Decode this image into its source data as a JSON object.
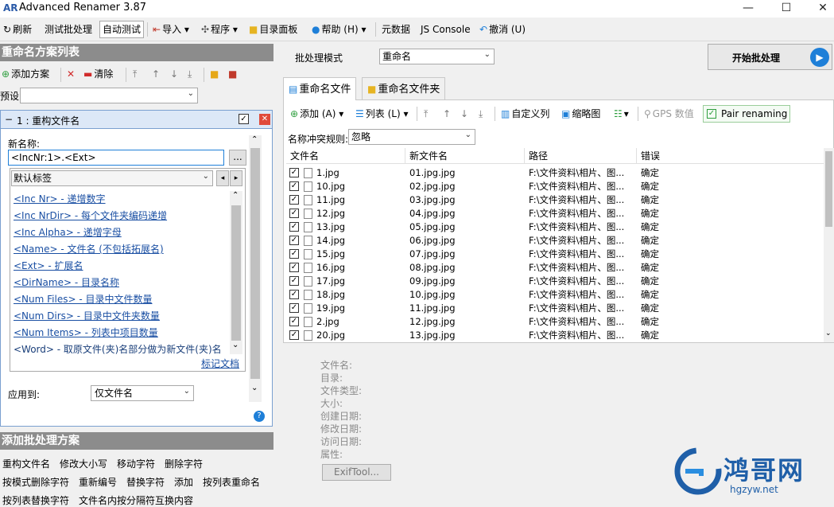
{
  "window": {
    "title": "Advanced Renamer 3.87",
    "app_icon": "AR",
    "minimize": "—",
    "maximize": "☐",
    "close": "✕"
  },
  "toolbar": {
    "refresh": "刷新",
    "test_batch": "测试批处理",
    "auto_test": "自动测试",
    "import": "导入",
    "program": "程序",
    "directory_panel": "目录面板",
    "help": "帮助 (H)",
    "metadata": "元数据",
    "js_console": "JS Console",
    "undo": "撤消 (U)"
  },
  "left": {
    "methods_header": "重命名方案列表",
    "add_method": "添加方案",
    "clear": "清除",
    "preset_label": "预设:",
    "preset_value": "",
    "method_title": "1 : 重构文件名",
    "method_collapse": "−",
    "new_name_label": "新名称:",
    "new_name_value": "<IncNr:1>.<Ext>",
    "browse": "...",
    "tag_group": "默认标签",
    "tags": [
      "<Inc Nr> - 递增数字",
      "<Inc NrDir> - 每个文件夹编码递增",
      "<Inc Alpha> - 递增字母",
      "<Name> - 文件名 (不包括拓展名)",
      "<Ext> - 扩展名",
      "<DirName> - 目录名称",
      "<Num Files> - 目录中文件数量",
      "<Num Dirs> - 目录中文件夹数量",
      "<Num Items> - 列表中项目数量",
      "<Word> - 取原文件(夹)名部分做为新文件(夹)名"
    ],
    "tag_docs": "标记文档",
    "apply_to_label": "应用到:",
    "apply_to_value": "仅文件名",
    "help_badge": "?",
    "batch_header": "添加批处理方案",
    "batch_methods_row1": [
      "重构文件名",
      "修改大小写",
      "移动字符",
      "删除字符"
    ],
    "batch_methods_row2": [
      "按模式删除字符",
      "重新编号",
      "替换字符",
      "添加",
      "按列表重命名"
    ],
    "batch_methods_row3": [
      "按列表替换字符",
      "文件名内按分隔符互换内容"
    ]
  },
  "right": {
    "batch_mode_label": "批处理模式",
    "batch_mode_value": "重命名",
    "start_button": "开始批处理",
    "tabs": [
      "重命名文件",
      "重命名文件夹"
    ],
    "add": "添加 (A)",
    "list": "列表 (L)",
    "custom_columns": "自定义列",
    "thumbnails": "缩略图",
    "gps": "GPS 数值",
    "pair_renaming": "Pair renaming",
    "conflict_label": "名称冲突规则:",
    "conflict_value": "忽略",
    "columns": [
      "文件名",
      "新文件名",
      "路径",
      "错误"
    ],
    "rows": [
      {
        "name": "1.jpg",
        "new": "01.jpg.jpg",
        "path": "F:\\文件资料\\相片、图...",
        "err": "确定"
      },
      {
        "name": "10.jpg",
        "new": "02.jpg.jpg",
        "path": "F:\\文件资料\\相片、图...",
        "err": "确定"
      },
      {
        "name": "11.jpg",
        "new": "03.jpg.jpg",
        "path": "F:\\文件资料\\相片、图...",
        "err": "确定"
      },
      {
        "name": "12.jpg",
        "new": "04.jpg.jpg",
        "path": "F:\\文件资料\\相片、图...",
        "err": "确定"
      },
      {
        "name": "13.jpg",
        "new": "05.jpg.jpg",
        "path": "F:\\文件资料\\相片、图...",
        "err": "确定"
      },
      {
        "name": "14.jpg",
        "new": "06.jpg.jpg",
        "path": "F:\\文件资料\\相片、图...",
        "err": "确定"
      },
      {
        "name": "15.jpg",
        "new": "07.jpg.jpg",
        "path": "F:\\文件资料\\相片、图...",
        "err": "确定"
      },
      {
        "name": "16.jpg",
        "new": "08.jpg.jpg",
        "path": "F:\\文件资料\\相片、图...",
        "err": "确定"
      },
      {
        "name": "17.jpg",
        "new": "09.jpg.jpg",
        "path": "F:\\文件资料\\相片、图...",
        "err": "确定"
      },
      {
        "name": "18.jpg",
        "new": "10.jpg.jpg",
        "path": "F:\\文件资料\\相片、图...",
        "err": "确定"
      },
      {
        "name": "19.jpg",
        "new": "11.jpg.jpg",
        "path": "F:\\文件资料\\相片、图...",
        "err": "确定"
      },
      {
        "name": "2.jpg",
        "new": "12.jpg.jpg",
        "path": "F:\\文件资料\\相片、图...",
        "err": "确定"
      },
      {
        "name": "20.jpg",
        "new": "13.jpg.jpg",
        "path": "F:\\文件资料\\相片、图...",
        "err": "确定"
      }
    ],
    "info_labels": [
      "文件名:",
      "目录:",
      "文件类型:",
      "大小:",
      "创建日期:",
      "修改日期:",
      "访问日期:",
      "属性:"
    ],
    "exiftool": "ExifTool..."
  },
  "watermark": {
    "brand": "鸿哥网",
    "url": "hgzyw.net"
  },
  "colors": {
    "accent": "#1e7fd8",
    "header_gray": "#8c8c8c",
    "link": "#1a4fa3",
    "watermark": "#1f5fa8"
  }
}
